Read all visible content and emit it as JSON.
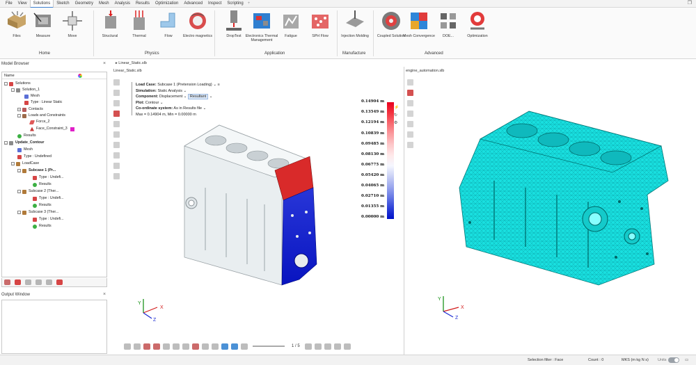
{
  "menu": {
    "items": [
      "File",
      "View",
      "Solutions",
      "Sketch",
      "Geometry",
      "Mesh",
      "Analysis",
      "Results",
      "Optimization",
      "Advanced",
      "Inspect",
      "Scripting"
    ],
    "active": "Solutions",
    "add_icon": "+"
  },
  "ribbon": {
    "buttons": {
      "files": "Files",
      "measure": "Measure",
      "move": "Move",
      "structural": "Structural",
      "thermal": "Thermal",
      "flow": "Flow",
      "electromagnetics": "Electro magnetics",
      "droptest": "DropTest",
      "electronics": "Electronics Thermal Management",
      "fatigue": "Fatigue",
      "sphflow": "SPH Flow",
      "injection": "Injection Molding",
      "coupled": "Coupled Solution",
      "meshconv": "Mesh Convergence",
      "doe": "DOE...",
      "optimization": "Optimization"
    },
    "groups": {
      "home": "Home",
      "physics": "Physics",
      "application": "Application",
      "manufacture": "Manufacture",
      "advanced": "Advanced"
    }
  },
  "model_browser": {
    "title": "Model Browser",
    "column_header": "Name",
    "nodes": {
      "solutions": "Solutions",
      "solution1": "Solution_1",
      "mesh1": "Mesh",
      "type1": "Type : Linear Static",
      "contacts": "Contacts",
      "loads": "Loads and Constraints",
      "force2": "Force_2",
      "faceconstraint": "Face_Constraint_3",
      "results1": "Results",
      "updatecontour": "Update_Contour",
      "mesh2": "Mesh",
      "type2": "Type : Undefined",
      "loadcase": "LoadCase",
      "sub1": "Subcase 1 (Pr...",
      "sub1type": "Type : Undefi...",
      "sub1results": "Results",
      "sub2": "Subcase 2 (Ther...",
      "sub2type": "Type : Undefi...",
      "sub2results": "Results",
      "sub3": "Subcase 3 (Ther...",
      "sub3type": "Type : Undefi...",
      "sub3results": "Results"
    }
  },
  "output_window": {
    "title": "Output Window"
  },
  "doc_tab": "Linear_Static.slb",
  "left_viewport": {
    "title": "Linear_Static.slb",
    "load_case_label": "Load Case:",
    "load_case_value": "Subcase 1 (Pretension Loading)",
    "simulation_label": "Simulation:",
    "simulation_value": "Static Analysis",
    "component_label": "Component:",
    "component_value": "Displacement",
    "component_sub": "Resultant",
    "plot_label": "Plot:",
    "plot_value": "Contour",
    "coord_label": "Co-ordinate system:",
    "coord_value": "As in Results file",
    "maxmin": "Max = 0.14904 m, Min = 0.00000 m"
  },
  "legend": {
    "values": [
      "0.14904 m",
      "0.13549 m",
      "0.12194 m",
      "0.10839 m",
      "0.09485 m",
      "0.08130 m",
      "0.06775 m",
      "0.05420 m",
      "0.04065 m",
      "0.02710 m",
      "0.01355 m",
      "0.00000 m"
    ],
    "colors": [
      "#e8001c",
      "#f3323f",
      "#f86a71",
      "#fb9ca0",
      "#fdc8ca",
      "#ffe9ea",
      "#f5f7ff",
      "#c9d0f5",
      "#9aa6ee",
      "#6476e4",
      "#2b3fd8",
      "#0010c9"
    ]
  },
  "right_viewport": {
    "title": "engine_automation.slb"
  },
  "bottom_toolbar": {
    "page": "1 / 5"
  },
  "axes": {
    "x": "X",
    "y": "Y",
    "z": "Z"
  },
  "status": {
    "selection_filter": "Selection filter : Face",
    "count": "Count : 0",
    "units_system": "MKS (m kg N s)",
    "units_label": "Units"
  },
  "colors": {
    "mesh_cyan": "#19e0e0",
    "accent_blue": "#3b7fd0"
  }
}
